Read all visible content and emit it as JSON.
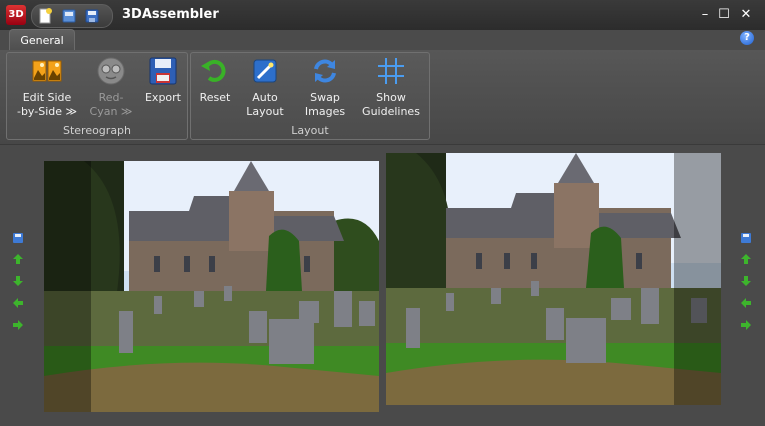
{
  "window": {
    "title": "3DAssembler",
    "logo_text": "3D"
  },
  "tabs": [
    {
      "label": "General"
    }
  ],
  "ribbon": {
    "groups": [
      {
        "caption": "Stereograph",
        "buttons": [
          {
            "label_line1": "Edit Side",
            "label_line2": "-by-Side ≫"
          },
          {
            "label_line1": "Red-",
            "label_line2": "Cyan ≫",
            "disabled": true
          },
          {
            "label_line1": "Export",
            "label_line2": ""
          }
        ]
      },
      {
        "caption": "Layout",
        "buttons": [
          {
            "label_line1": "Reset",
            "label_line2": ""
          },
          {
            "label_line1": "Auto",
            "label_line2": "Layout"
          },
          {
            "label_line1": "Swap",
            "label_line2": "Images"
          },
          {
            "label_line1": "Show",
            "label_line2": "Guidelines"
          }
        ]
      }
    ]
  },
  "icons": {
    "help": "?",
    "minimize": "–",
    "maximize": "☐",
    "close": "✕"
  },
  "colors": {
    "accent_green": "#3db52c",
    "accent_blue": "#2f7ad8"
  }
}
